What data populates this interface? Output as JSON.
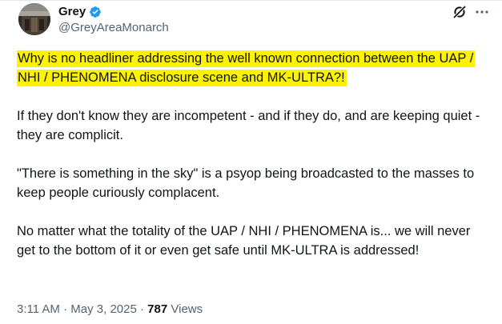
{
  "author": {
    "display_name": "Grey",
    "handle": "@GreyAreaMonarch",
    "verified": true
  },
  "icons": {
    "verified": "verified-badge-icon",
    "grok": "grok-icon",
    "more": "more-options-icon"
  },
  "colors": {
    "highlight": "#fff200",
    "verified_blue": "#1d9bf0",
    "secondary_text": "#536471"
  },
  "tweet": {
    "highlighted_text": "Why is no headliner addressing the well known connection between the UAP / NHI / PHENOMENA disclosure scene and MK-ULTRA?!",
    "paragraphs": [
      "If they don't know they are incompetent - and if they do,  and are keeping quiet - they are complicit.",
      "\"There is something in the sky\" is a psyop being broadcasted to the masses to keep people curiously complacent.",
      "No matter what the totality of the UAP / NHI / PHENOMENA is... we will never get to the bottom of it or even get safe until MK-ULTRA is addressed!"
    ]
  },
  "meta": {
    "time": "3:11 AM",
    "separator": "·",
    "date": "May 3, 2025",
    "views_count": "787",
    "views_label": "Views"
  }
}
